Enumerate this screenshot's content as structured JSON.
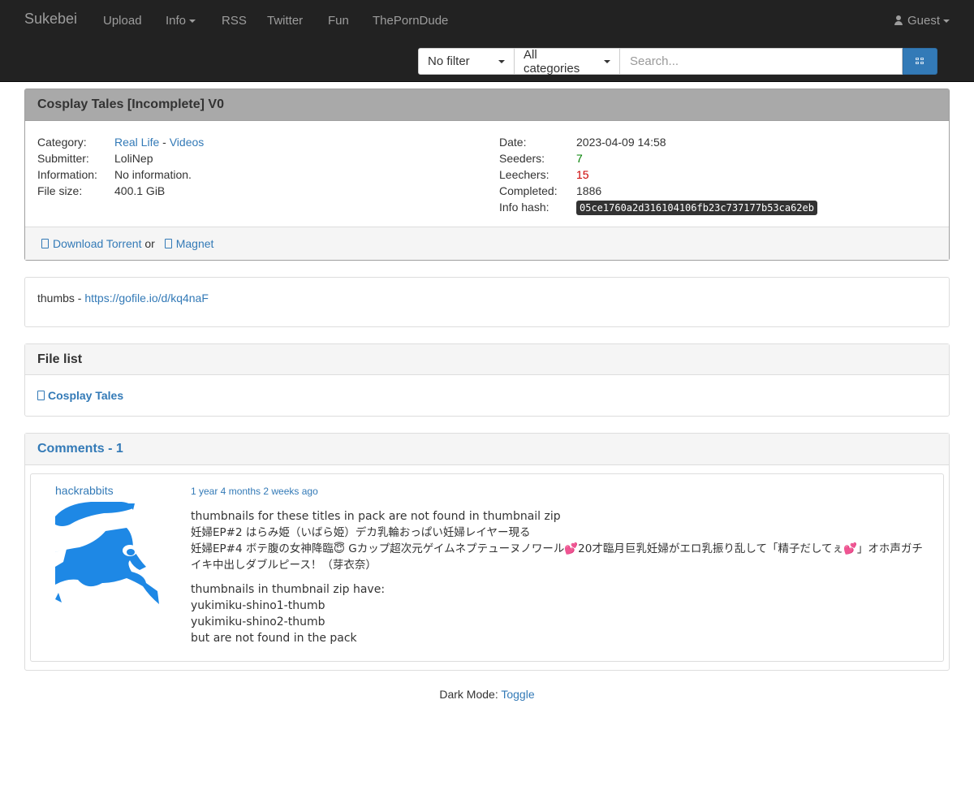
{
  "navbar": {
    "brand": "Sukebei",
    "items": [
      "Upload",
      "Info",
      "RSS",
      "Twitter",
      "Fun",
      "ThePornDude"
    ],
    "user": "Guest"
  },
  "search": {
    "filter": "No filter",
    "category": "All categories",
    "placeholder": "Search..."
  },
  "torrent": {
    "title": "Cosplay Tales [Incomplete] V0",
    "labels": {
      "category": "Category:",
      "submitter": "Submitter:",
      "information": "Information:",
      "file_size": "File size:",
      "date": "Date:",
      "seeders": "Seeders:",
      "leechers": "Leechers:",
      "completed": "Completed:",
      "info_hash": "Info hash:"
    },
    "category_main": "Real Life",
    "category_sep": " - ",
    "category_sub": "Videos",
    "submitter": "LoliNep",
    "information": "No information.",
    "file_size": "400.1 GiB",
    "date": "2023-04-09 14:58",
    "seeders": "7",
    "leechers": "15",
    "completed": "1886",
    "info_hash": "05ce1760a2d316104106fb23c737177b53ca62eb",
    "download_label": "Download Torrent",
    "or_text": " or ",
    "magnet_label": "Magnet"
  },
  "description": {
    "prefix": "thumbs - ",
    "link": "https://gofile.io/d/kq4naF"
  },
  "files": {
    "heading": "File list",
    "folder": "Cosplay Tales"
  },
  "comments": {
    "heading": "Comments - 1",
    "items": [
      {
        "user": "hackrabbits",
        "time": "1 year 4 months 2 weeks ago",
        "lines1": [
          "thumbnails for these titles in pack are not found in thumbnail zip",
          "妊婦EP#2 はらみ姫（いばら姫）デカ乳輪おっぱい妊婦レイヤー現る",
          "妊婦EP#4 ボテ腹の女神降臨😇 Gカップ超次元ゲイムネプテューヌノワール💕20才臨月巨乳妊婦がエロ乳振り乱して「精子だしてぇ💕」オホ声ガチ",
          "イキ中出しダブルピース！（芽衣奈）"
        ],
        "lines2": [
          "thumbnails in thumbnail zip have:",
          "yukimiku-shino1-thumb",
          "yukimiku-shino2-thumb",
          "but are not found in the pack"
        ]
      }
    ]
  },
  "footer": {
    "label": "Dark Mode: ",
    "toggle": "Toggle"
  },
  "colors": {
    "navbar_bg": "#222222",
    "link": "#337ab7",
    "seeders": "#008000",
    "leechers": "#cc0000",
    "avatar": "#1e88e5"
  }
}
